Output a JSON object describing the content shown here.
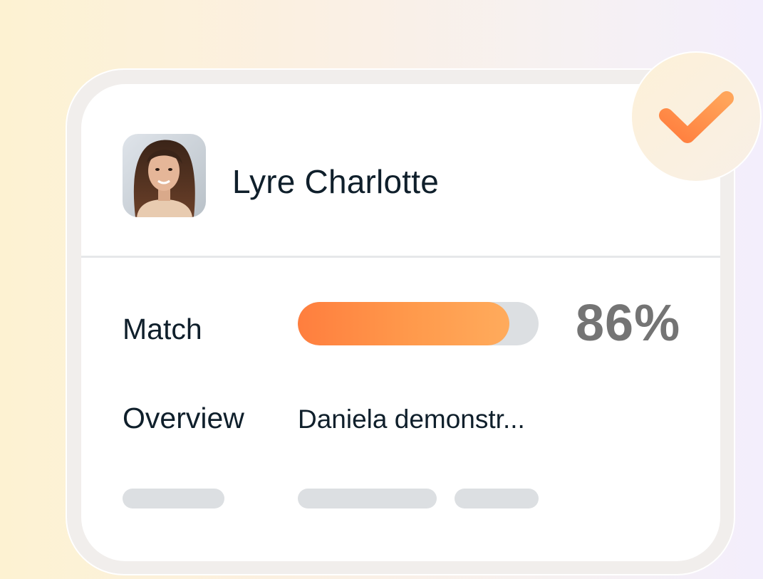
{
  "candidate": {
    "name": "Lyre Charlotte",
    "avatar_icon": "person-photo",
    "status_icon": "checkmark-icon"
  },
  "match": {
    "label": "Match",
    "percent_text": "86%",
    "progress_fraction": 0.88
  },
  "overview": {
    "label": "Overview",
    "text": "Daniela demonstr..."
  },
  "colors": {
    "accent_start": "#ff7e3e",
    "accent_end": "#ffab5c",
    "text_primary": "#0f1f2b",
    "percent_text": "#747474",
    "placeholder": "#dcdfe2"
  }
}
